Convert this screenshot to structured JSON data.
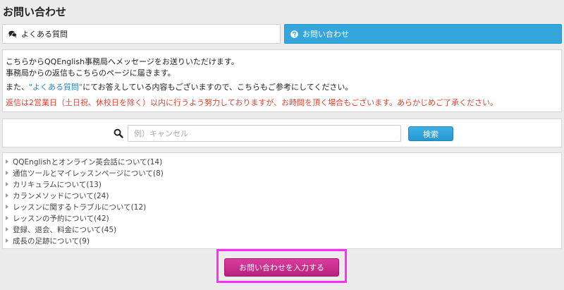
{
  "page": {
    "title": "お問い合わせ"
  },
  "tabs": [
    {
      "label": "よくある質問",
      "icon": "speech-bubbles-icon"
    },
    {
      "label": "お問い合わせ",
      "icon": "question-circle-icon"
    }
  ],
  "info": {
    "line1": "こちらからQQEnglish事務局へメッセージをお送りいただけます。",
    "line2": "事務局からの返信もこちらのページに届きます。",
    "line3_before": "また、",
    "line3_link": "\"よくある質問\"",
    "line3_after": "にてお答えしている内容もございますので、こちらもご参考にしてください。",
    "notice": "返信は2営業日（土日祝、休校日を除く）以内に行うよう努力しておりますが、お時間を頂く場合もございます。あらかじめご了承ください。"
  },
  "search": {
    "placeholder": "例）キャンセル",
    "value": "",
    "button_label": "検索",
    "icon": "search-icon"
  },
  "categories": [
    "QQEnglishとオンライン英会話について(14)",
    "通信ツールとマイレッスンページについて(8)",
    "カリキュラムについて(13)",
    "カランメソッドについて(24)",
    "レッスンに関するトラブルについて(12)",
    "レッスンの予約について(42)",
    "登録、退会、料金について(45)",
    "成長の足跡について(9)"
  ],
  "cta": {
    "label": "お問い合わせを入力する"
  },
  "colors": {
    "background": "#ececec",
    "tab_active": "#35a6dc",
    "link": "#2b87c8",
    "notice": "#e0412e",
    "cta": "#c62b8c",
    "highlight": "#ff30ff"
  }
}
